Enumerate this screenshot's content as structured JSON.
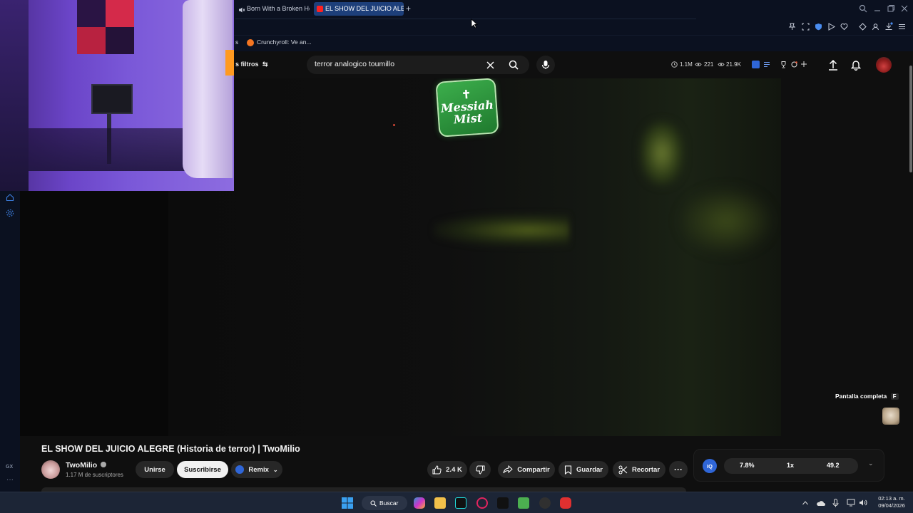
{
  "browser": {
    "tabs": [
      {
        "label": "Born With a Broken He"
      },
      {
        "label": "EL SHOW DEL JUICIO ALE"
      }
    ],
    "new_tab": "+",
    "bookmarks": [
      {
        "label": "s"
      },
      {
        "label": "Crunchyroll: Ve an..."
      }
    ]
  },
  "youtube": {
    "filters_label": "s filtros",
    "search": {
      "value": "terror analogico toumillo"
    },
    "stats": {
      "views": "1.1M",
      "eye": "221",
      "watch": "21.9K"
    },
    "video": {
      "logo_line1": "Messiah",
      "logo_line2": "Mist",
      "fullscreen_label": "Pantalla completa",
      "fullscreen_key": "F"
    },
    "title": "EL SHOW DEL JUICIO ALEGRE (Historia de terror) | TwoMilio",
    "channel": {
      "name": "TwoMilio",
      "subscribers": "1.17 M de suscriptores",
      "join_label": "Unirse",
      "subscribe_label": "Suscribirse",
      "remix_label": "Remix"
    },
    "actions": {
      "likes": "2.4 K",
      "share": "Compartir",
      "save": "Guardar",
      "clip": "Recortar"
    },
    "iq_bar": {
      "badge": "IQ",
      "percent": "7.8%",
      "speed": "1x",
      "score": "49.2"
    }
  },
  "sidebar": {
    "gx_label": "GX"
  },
  "taskbar": {
    "search_label": "Buscar",
    "time": "02:13 a. m.",
    "date": "09/04/2026"
  },
  "colors": {
    "tab_active": "#1d3f7a",
    "yt_bg": "#0f0f0f",
    "logo_green": "#2c8c3c",
    "iq_blue": "#2f66d8"
  }
}
